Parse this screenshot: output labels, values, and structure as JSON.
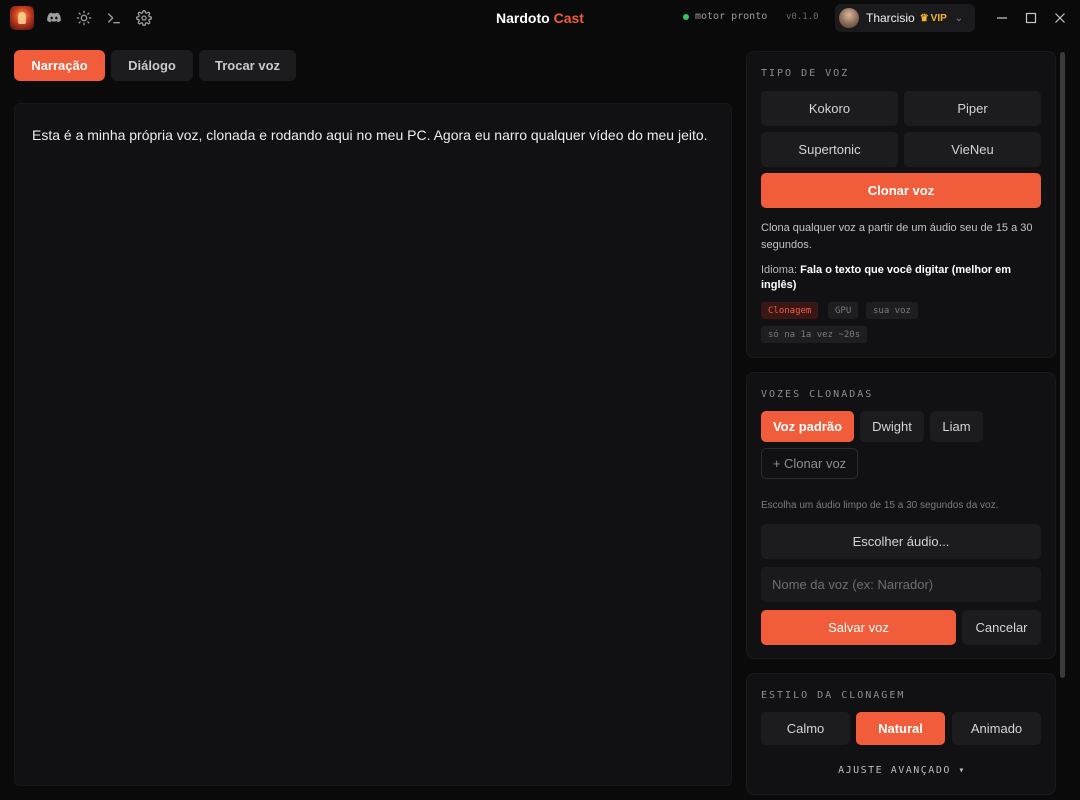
{
  "window": {
    "title_part1": "Nardoto",
    "title_part2": "Cast",
    "status": "motor pronto",
    "version": "v0.1.0",
    "user_name": "Tharcisio",
    "user_badge": "VIP",
    "status_color": "#35c26a",
    "accent_color": "#f15d3a"
  },
  "toolbar": {
    "icons": [
      "discord-icon",
      "sun-icon",
      "terminal-icon",
      "gear-icon"
    ]
  },
  "tabs": [
    {
      "label": "Narração",
      "active": true
    },
    {
      "label": "Diálogo",
      "active": false
    },
    {
      "label": "Trocar voz",
      "active": false
    }
  ],
  "editor": {
    "text": "Esta é a minha própria voz, clonada e rodando aqui no meu PC. Agora eu narro qualquer vídeo do meu jeito."
  },
  "voice_type": {
    "title": "TIPO DE VOZ",
    "options": [
      "Kokoro",
      "Piper",
      "Supertonic",
      "VieNeu"
    ],
    "clone_button": "Clonar voz",
    "description": "Clona qualquer voz a partir de um áudio seu de 15 a 30 segundos.",
    "language_label": "Idioma:",
    "language_value": "Fala o texto que você digitar (melhor em inglês)",
    "tags": [
      "Clonagem",
      "GPU",
      "sua voz",
      "só na 1a vez ~20s"
    ]
  },
  "cloned_voices": {
    "title": "VOZES CLONADAS",
    "voices": [
      {
        "label": "Voz padrão",
        "active": true
      },
      {
        "label": "Dwight",
        "active": false
      },
      {
        "label": "Liam",
        "active": false
      }
    ],
    "add_button": "+ Clonar voz",
    "hint": "Escolha um áudio limpo de 15 a 30 segundos da voz.",
    "choose_audio": "Escolher áudio...",
    "name_placeholder": "Nome da voz (ex: Narrador)",
    "save_button": "Salvar voz",
    "cancel_button": "Cancelar"
  },
  "clone_style": {
    "title": "ESTILO DA CLONAGEM",
    "options": [
      {
        "label": "Calmo",
        "active": false
      },
      {
        "label": "Natural",
        "active": true
      },
      {
        "label": "Animado",
        "active": false
      }
    ],
    "advanced_label": "AJUSTE AVANÇADO"
  }
}
